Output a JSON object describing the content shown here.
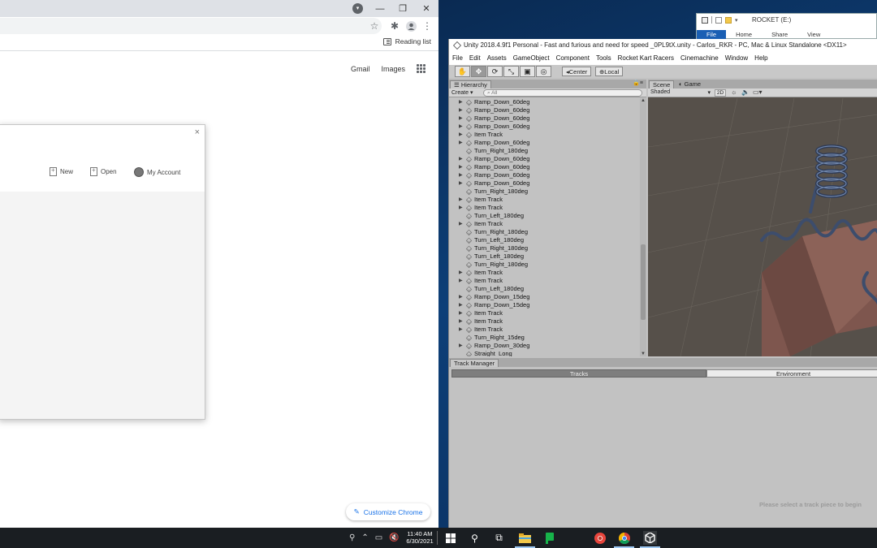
{
  "chrome": {
    "reading_list_label": "Reading list",
    "ntp_links": [
      "Gmail",
      "Images"
    ],
    "dialog": {
      "close_label": "×",
      "new_label": "New",
      "open_label": "Open",
      "account_label": "My Account"
    },
    "customize_label": "Customize Chrome"
  },
  "explorer": {
    "title": "ROCKET (E:)",
    "ribbon_tabs": [
      "File",
      "Home",
      "Share",
      "View"
    ]
  },
  "unity": {
    "title": "Unity 2018.4.9f1 Personal - Fast and furious and need for speed _0PL9tX.unity - Carlos_RKR - PC, Mac & Linux Standalone <DX11>",
    "menu": [
      "File",
      "Edit",
      "Assets",
      "GameObject",
      "Component",
      "Tools",
      "Rocket Kart Racers",
      "Cinemachine",
      "Window",
      "Help"
    ],
    "pivot_center_label": "Center",
    "pivot_local_label": "Local",
    "hierarchy": {
      "tab_label": "Hierarchy",
      "create_label": "Create ▾",
      "search_placeholder": "All",
      "rows": [
        {
          "label": "Ramp_Down_60deg",
          "expandable": true
        },
        {
          "label": "Ramp_Down_60deg",
          "expandable": true
        },
        {
          "label": "Ramp_Down_60deg",
          "expandable": true
        },
        {
          "label": "Ramp_Down_60deg",
          "expandable": true
        },
        {
          "label": "Item Track",
          "expandable": true
        },
        {
          "label": "Ramp_Down_60deg",
          "expandable": true
        },
        {
          "label": "Turn_Right_180deg",
          "expandable": false
        },
        {
          "label": "Ramp_Down_60deg",
          "expandable": true
        },
        {
          "label": "Ramp_Down_60deg",
          "expandable": true
        },
        {
          "label": "Ramp_Down_60deg",
          "expandable": true
        },
        {
          "label": "Ramp_Down_60deg",
          "expandable": true
        },
        {
          "label": "Turn_Right_180deg",
          "expandable": false
        },
        {
          "label": "Item Track",
          "expandable": true
        },
        {
          "label": "Item Track",
          "expandable": true
        },
        {
          "label": "Turn_Left_180deg",
          "expandable": false
        },
        {
          "label": "Item Track",
          "expandable": true
        },
        {
          "label": "Turn_Right_180deg",
          "expandable": false
        },
        {
          "label": "Turn_Left_180deg",
          "expandable": false
        },
        {
          "label": "Turn_Right_180deg",
          "expandable": false
        },
        {
          "label": "Turn_Left_180deg",
          "expandable": false
        },
        {
          "label": "Turn_Right_180deg",
          "expandable": false
        },
        {
          "label": "Item Track",
          "expandable": true
        },
        {
          "label": "Item Track",
          "expandable": true
        },
        {
          "label": "Turn_Left_180deg",
          "expandable": false
        },
        {
          "label": "Ramp_Down_15deg",
          "expandable": true
        },
        {
          "label": "Ramp_Down_15deg",
          "expandable": true
        },
        {
          "label": "Item Track",
          "expandable": true
        },
        {
          "label": "Item Track",
          "expandable": true
        },
        {
          "label": "Item Track",
          "expandable": true
        },
        {
          "label": "Turn_Right_15deg",
          "expandable": false
        },
        {
          "label": "Ramp_Down_30deg",
          "expandable": true
        },
        {
          "label": "Straight_Long",
          "expandable": false
        }
      ]
    },
    "scene": {
      "tabs": [
        "Scene",
        "Game"
      ],
      "shading_label": "Shaded",
      "mode_2d_label": "2D"
    },
    "track_manager": {
      "tab_label": "Track Manager",
      "tracks_label": "Tracks",
      "environment_label": "Environment",
      "message": "Please select a track piece to begin"
    }
  },
  "taskbar": {
    "time": "11:40 AM",
    "date": "6/30/2021"
  }
}
